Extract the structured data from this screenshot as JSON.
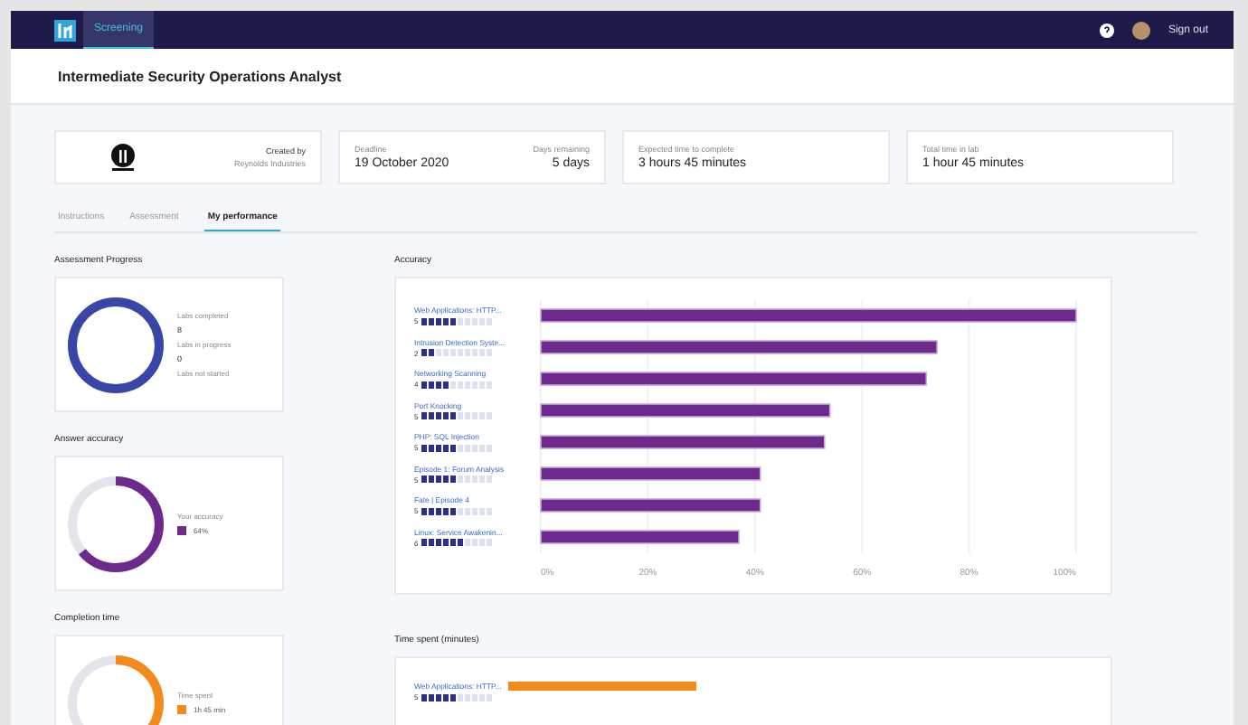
{
  "nav": {
    "tabs": [
      {
        "label": "Screening",
        "selected": true
      }
    ],
    "sign_out": "Sign out"
  },
  "title": "Intermediate Security Operations Analyst",
  "info": {
    "created_by_label": "Created by",
    "created_by": "Reynolds Industries",
    "deadline_label": "Deadline",
    "deadline": "19 October 2020",
    "remaining_label": "Days remaining",
    "remaining": "5 days",
    "expected_label": "Expected time to complete",
    "expected": "3 hours 45 minutes",
    "total_label": "Total time in lab",
    "total": "1 hour 45 minutes"
  },
  "tabs": [
    {
      "label": "Instructions",
      "selected": false
    },
    {
      "label": "Assessment",
      "selected": false
    },
    {
      "label": "My performance",
      "selected": true
    }
  ],
  "progress": {
    "title": "Assessment Progress",
    "level": 1,
    "color": "#3a45a8",
    "legend": [
      {
        "label": "Labs completed",
        "value": "8"
      },
      {
        "label": "Labs in progress",
        "value": "0"
      },
      {
        "label": "Labs not started"
      }
    ]
  },
  "accuracy_donut": {
    "title": "Answer accuracy",
    "level": 0.64,
    "color": "#6b2a8c",
    "legend_label": "Your accuracy",
    "value": "64%"
  },
  "completion": {
    "title": "Completion time",
    "level": 0.42,
    "color": "#f28a1c",
    "legend_label": "Time spent",
    "value": "1h 45 min"
  },
  "accuracy": {
    "difficulty": [
      {
        "value": "5",
        "stars": 5
      },
      {
        "value": "2",
        "stars": 2
      },
      {
        "value": "4",
        "stars": 4
      },
      {
        "value": "5",
        "stars": 5
      },
      {
        "value": "5",
        "stars": 5
      },
      {
        "value": "5",
        "stars": 5
      },
      {
        "value": "5",
        "stars": 5
      },
      {
        "value": "6",
        "stars": 6
      }
    ],
    "chart_data": {
      "type": "bar",
      "orientation": "horizontal",
      "title": "Accuracy",
      "categories": [
        "Web Applications: HTTP...",
        "Intrusion Detection Syste...",
        "Networking Scanning",
        "Port Knocking",
        "PHP: SQL Injection",
        "Episode 1: Forum Analysis",
        "Fate | Episode 4",
        "Linux: Service Awakenin..."
      ],
      "series": [
        {
          "color": "#6b2a8c",
          "values": [
            100,
            74,
            72,
            54,
            53,
            41,
            41,
            37
          ]
        }
      ],
      "grid": true,
      "xlim": [
        0,
        100
      ],
      "xticks": [
        {
          "value": 0,
          "label": "0%"
        },
        {
          "value": 20,
          "label": "20%"
        },
        {
          "value": 40,
          "label": "40%"
        },
        {
          "value": 60,
          "label": "60%"
        },
        {
          "value": 80,
          "label": "80%"
        },
        {
          "value": 100,
          "label": "100%"
        }
      ]
    }
  },
  "time_spent": {
    "title": "Time spent (minutes)",
    "rows": [
      {
        "label": "Web Applications: HTTP...",
        "difficulty": "5",
        "stars": 5
      }
    ]
  }
}
